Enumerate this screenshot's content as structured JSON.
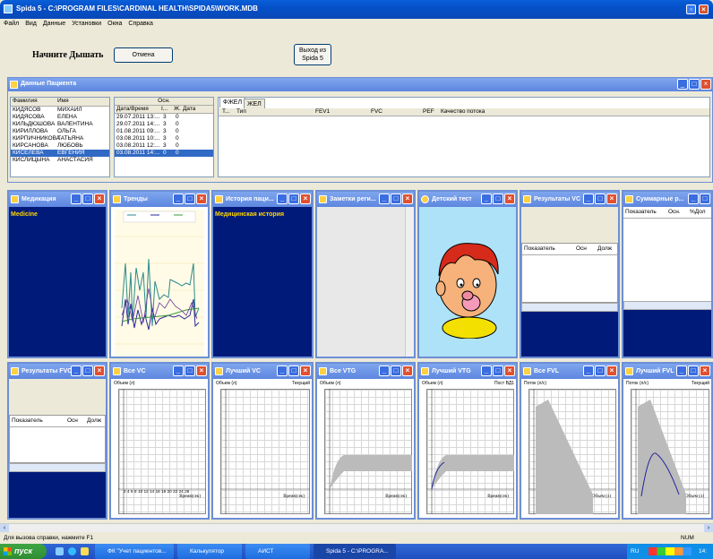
{
  "app": {
    "title": "Spida 5 - C:\\PROGRAM FILES\\CARDINAL HEALTH\\SPIDA5\\WORK.MDB"
  },
  "menu": [
    "Файл",
    "Вид",
    "Данные",
    "Установки",
    "Окна",
    "Справка"
  ],
  "toolbar": {
    "heading": "Начните Дышать",
    "cancel": "Отмена",
    "exit": "Выход из Spida 5"
  },
  "patient_panel": {
    "title": "Данные Пациента",
    "col_last": "Фамилия",
    "col_first": "Имя",
    "rows": [
      [
        "КИДЯСОВ",
        "МИХАИЛ"
      ],
      [
        "КИДЯСОВА",
        "ЕЛЕНА"
      ],
      [
        "КИЛЬДЮШОВА",
        "ВАЛЕНТИНА"
      ],
      [
        "КИРИЛЛОВА",
        "ОЛЬГА"
      ],
      [
        "КИРПИЧНИКОВА",
        "ТАТЬЯНА"
      ],
      [
        "КИРСАНОВА",
        "ЛЮБОВЬ"
      ],
      [
        "КИСЕЛЕВА",
        "ЕВГЕНИЯ"
      ],
      [
        "КИСЛИЦЫНА",
        "АНАСТАСИЯ"
      ]
    ],
    "visits_header": "Осн.",
    "col_date": "Дата/Время",
    "col_i": "І...",
    "col_zh": "Ж.",
    "col_date2": "Дата",
    "visits": [
      [
        "29.07.2011 13:...",
        "3",
        "0"
      ],
      [
        "29.07.2011 14:...",
        "3",
        "0"
      ],
      [
        "01.08.2011 09:...",
        "3",
        "0"
      ],
      [
        "03.08.2011 10:...",
        "3",
        "0"
      ],
      [
        "03.08.2011 12:...",
        "3",
        "0"
      ],
      [
        "03.08.2011 14:...",
        "0",
        "0"
      ]
    ],
    "tabs": [
      "ФЖЕЛ",
      "ЖЕЛ"
    ],
    "cols": [
      "Т...",
      "Тип",
      "FEV1",
      "FVC",
      "PEF",
      "Качество потока"
    ]
  },
  "panels_row1": [
    {
      "title": "Медикация",
      "body": "Medicine"
    },
    {
      "title": "Тренды"
    },
    {
      "title": "История паци...",
      "body": "Медицинская история"
    },
    {
      "title": "Заметки реги..."
    },
    {
      "title": "Детский тест"
    },
    {
      "title": "Результаты VC",
      "c1": "Показатель",
      "c2": "Осн",
      "c3": "Долж"
    },
    {
      "title": "Суммарные р...",
      "c1": "Показатель",
      "c2": "Осн.",
      "c3": "%Дол"
    }
  ],
  "panels_row2": [
    {
      "title": "Результаты FVC",
      "c1": "Показатель",
      "c2": "Осн",
      "c3": "Долж"
    },
    {
      "title": "Все VC",
      "y": "Объем (л)",
      "x": "Время(сек)",
      "ticks": [
        "2",
        "4",
        "6",
        "8",
        "10",
        "12",
        "14",
        "16",
        "18",
        "20",
        "22",
        "24",
        "26"
      ]
    },
    {
      "title": "Лучший VC",
      "y": "Объем (л)",
      "x": "Время(сек)",
      "legend": "Текущий"
    },
    {
      "title": "Все VTG",
      "y": "Объем (л)",
      "x": "Время(сек)"
    },
    {
      "title": "Лучший VTG",
      "y": "Объем (л)",
      "x": "Время(сек)",
      "legend": "Пост ВД1"
    },
    {
      "title": "Все FVL",
      "y": "Поток (л/с)",
      "x": "Объем (л)"
    },
    {
      "title": "Лучший FVL",
      "y": "Поток (л/с)",
      "x": "Объем (л)",
      "legend": "Текущий"
    }
  ],
  "status": {
    "left": "Для вызова справки, нажмите F1",
    "right": "NUM"
  },
  "taskbar": {
    "start": "пуск",
    "items": [
      "ФК \"Учет пациентов...",
      "Калькулятор",
      "АИСТ",
      "Spida 5 - C:\\PROGRA..."
    ],
    "lang": "RU",
    "clock": "14:"
  }
}
